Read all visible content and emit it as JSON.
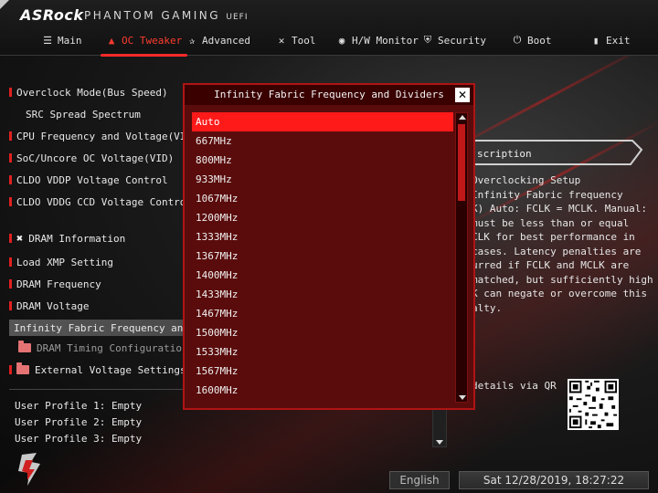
{
  "header": {
    "brand": "ASRock",
    "product": "PHANTOM GAMING",
    "uefi": "UEFI"
  },
  "tabs": [
    {
      "label": "Main",
      "icon": "list-icon"
    },
    {
      "label": "OC Tweaker",
      "icon": "flame-icon",
      "active": true
    },
    {
      "label": "Advanced",
      "icon": "star-icon"
    },
    {
      "label": "Tool",
      "icon": "tools-icon"
    },
    {
      "label": "H/W Monitor",
      "icon": "monitor-icon"
    },
    {
      "label": "Security",
      "icon": "shield-icon"
    },
    {
      "label": "Boot",
      "icon": "power-icon"
    },
    {
      "label": "Exit",
      "icon": "exit-icon"
    }
  ],
  "menu": [
    {
      "label": "Overclock Mode(Bus Speed)"
    },
    {
      "label": "SRC Spread Spectrum"
    },
    {
      "label": "CPU Frequency and Voltage(VID) Ch"
    },
    {
      "label": "SoC/Uncore OC Voltage(VID)"
    },
    {
      "label": "CLDO VDDP Voltage Control"
    },
    {
      "label": "CLDO VDDG CCD Voltage Control"
    },
    {
      "label": "DRAM Information"
    },
    {
      "label": "Load XMP Setting"
    },
    {
      "label": "DRAM Frequency"
    },
    {
      "label": "DRAM Voltage"
    },
    {
      "label": "Infinity Fabric Frequency and Di"
    },
    {
      "label": "DRAM Timing Configuration"
    },
    {
      "label": "External Voltage Settings and"
    }
  ],
  "profiles": [
    "User Profile 1: Empty",
    "User Profile 2: Empty",
    "User Profile 3: Empty"
  ],
  "description": {
    "title": "scription",
    "text": "Overclocking Setup\nInfinity Fabric frequency\nK) Auto: FCLK = MCLK. Manual:\nmust be less than or equal\nCLK for best performance in\ncases. Latency penalties are\nurred if FCLK and MCLK are\nmatched, but sufficiently high\nK can negate or overcome this\nalty.",
    "qr_text": "details via QR"
  },
  "popup": {
    "title": "Infinity Fabric Frequency and Dividers",
    "close": "✕",
    "options": [
      "Auto",
      "667MHz",
      "800MHz",
      "933MHz",
      "1067MHz",
      "1200MHz",
      "1333MHz",
      "1367MHz",
      "1400MHz",
      "1433MHz",
      "1467MHz",
      "1500MHz",
      "1533MHz",
      "1567MHz",
      "1600MHz"
    ],
    "selected": "Auto"
  },
  "footer": {
    "language": "English",
    "datetime": "Sat 12/28/2019, 18:27:22"
  },
  "colors": {
    "accent": "#ff1a1a",
    "popup_bg": "#5a0c0c",
    "popup_border": "#b01414"
  }
}
